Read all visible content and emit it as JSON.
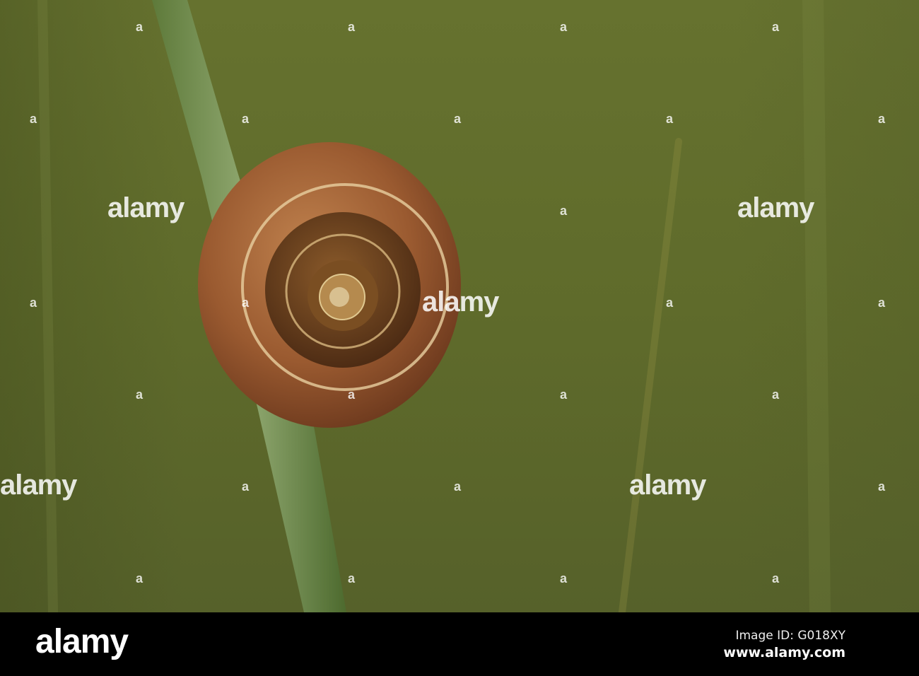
{
  "watermark": {
    "text": "alamy",
    "mark": "a"
  },
  "footer": {
    "logo": "alamy",
    "image_id": "Image ID: G018XY",
    "url": "www.alamy.com"
  }
}
